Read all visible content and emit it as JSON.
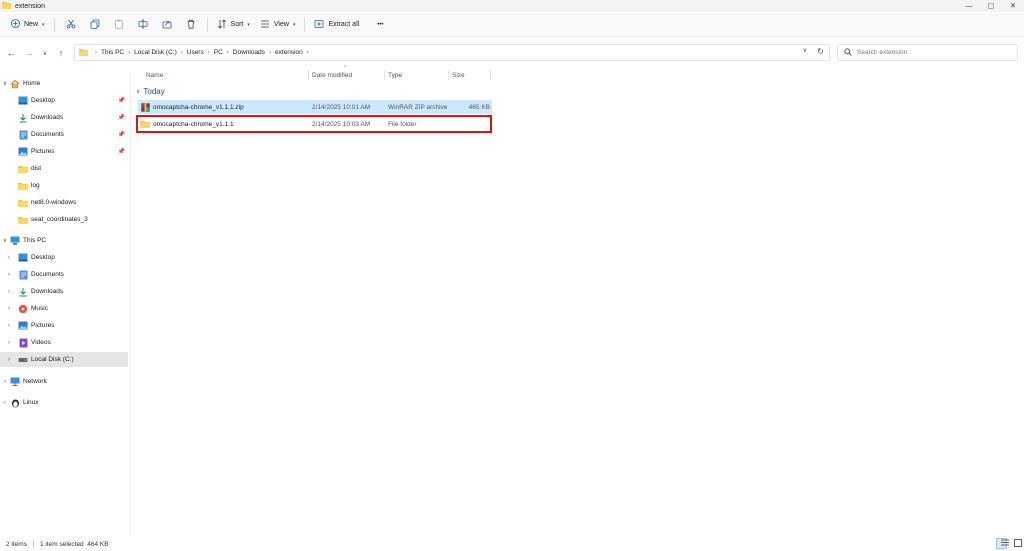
{
  "window": {
    "title": "extension",
    "min": "—",
    "max": "▢",
    "close": "✕"
  },
  "toolbar": {
    "new_label": "New",
    "sort_label": "Sort",
    "view_label": "View",
    "extract_label": "Extract all",
    "more_label": "•••"
  },
  "address": {
    "crumbs": [
      "This PC",
      "Local Disk (C:)",
      "Users",
      "PC",
      "Downloads",
      "extension"
    ],
    "search_placeholder": "Search extension"
  },
  "sidebar": {
    "home": "Home",
    "quick": [
      {
        "label": "Desktop",
        "icon": "desktop-icon",
        "pinned": true
      },
      {
        "label": "Downloads",
        "icon": "download-icon",
        "pinned": true
      },
      {
        "label": "Documents",
        "icon": "documents-icon",
        "pinned": true
      },
      {
        "label": "Pictures",
        "icon": "pictures-icon",
        "pinned": true
      },
      {
        "label": "dist",
        "icon": "folder-icon",
        "pinned": false
      },
      {
        "label": "log",
        "icon": "folder-icon",
        "pinned": false
      },
      {
        "label": "net8.0-windows",
        "icon": "folder-icon",
        "pinned": false
      },
      {
        "label": "seat_coordinates_3",
        "icon": "folder-icon",
        "pinned": false
      }
    ],
    "this_pc": "This PC",
    "pc_items": [
      {
        "label": "Desktop",
        "icon": "desktop-icon"
      },
      {
        "label": "Documents",
        "icon": "documents-icon"
      },
      {
        "label": "Downloads",
        "icon": "download-icon"
      },
      {
        "label": "Music",
        "icon": "music-icon"
      },
      {
        "label": "Pictures",
        "icon": "pictures-icon"
      },
      {
        "label": "Videos",
        "icon": "videos-icon"
      },
      {
        "label": "Local Disk (C:)",
        "icon": "drive-icon"
      }
    ],
    "network": "Network",
    "linux": "Linux"
  },
  "columns": {
    "name": "Name",
    "date": "Date modified",
    "type": "Type",
    "size": "Size"
  },
  "group": "Today",
  "files": [
    {
      "name": "omocaptcha-chrome_v1.1.1.zip",
      "date": "2/14/2025 10:01 AM",
      "type": "WinRAR ZIP archive",
      "size": "465 KB",
      "icon": "zip-archive-icon",
      "selected": true
    },
    {
      "name": "omocaptcha-chrome_v1.1.1",
      "date": "2/14/2025 10:03 AM",
      "type": "File folder",
      "size": "",
      "icon": "folder-icon",
      "selected": false
    }
  ],
  "status": {
    "count": "2 items",
    "selection": "1 item selected  464 KB"
  },
  "colors": {
    "accent": "#0067c0",
    "folder": "#f4c24a",
    "selection": "#cce8ff",
    "highlight": "#e0101b"
  }
}
